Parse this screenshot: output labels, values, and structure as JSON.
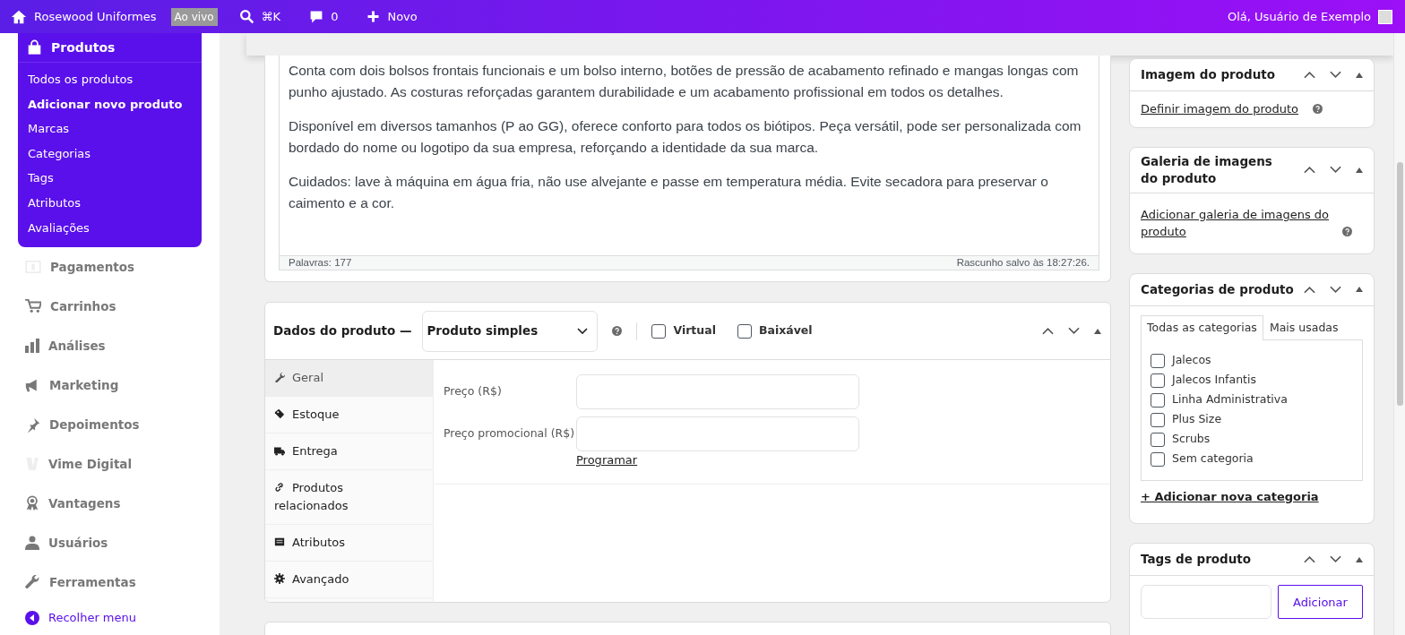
{
  "topbar": {
    "site": "Rosewood Uniformes",
    "live_badge": "Ao vivo",
    "search_shortcut": "⌘K",
    "comments": "0",
    "new_label": "Novo",
    "greeting": "Olá, Usuário de Exemplo"
  },
  "sidebar": {
    "flyout": {
      "title": "Produtos",
      "items": [
        {
          "label": "Todos os produtos",
          "selected": false
        },
        {
          "label": "Adicionar novo produto",
          "selected": true
        },
        {
          "label": "Marcas",
          "selected": false
        },
        {
          "label": "Categorias",
          "selected": false
        },
        {
          "label": "Tags",
          "selected": false
        },
        {
          "label": "Atributos",
          "selected": false
        },
        {
          "label": "Avaliações",
          "selected": false
        }
      ]
    },
    "items": [
      {
        "label": "Pagamentos"
      },
      {
        "label": "Carrinhos"
      },
      {
        "label": "Análises"
      },
      {
        "label": "Marketing"
      },
      {
        "label": "Depoimentos"
      },
      {
        "label": "Vime Digital"
      },
      {
        "label": "Vantagens"
      },
      {
        "label": "Usuários"
      },
      {
        "label": "Ferramentas"
      }
    ],
    "collapse": "Recolher menu"
  },
  "editor": {
    "paragraphs": [
      "Conta com dois bolsos frontais funcionais e um bolso interno, botões de pressão de acabamento refinado e mangas longas com punho ajustado. As costuras reforçadas garantem durabilidade e um acabamento profissional em todos os detalhes.",
      "Disponível em diversos tamanhos (P ao GG), oferece conforto para todos os biótipos. Peça versátil, pode ser personalizada com bordado do nome ou logotipo da sua empresa, reforçando a identidade da sua marca.",
      "Cuidados: lave à máquina em água fria, não use alvejante e passe em temperatura média. Evite secadora para preservar o caimento e a cor."
    ],
    "word_count": "Palavras: 177",
    "draft_saved": "Rascunho salvo às 18:27:26."
  },
  "product_data": {
    "title": "Dados do produto —",
    "type": "Produto simples",
    "options": [
      {
        "label": "Virtual",
        "checked": false
      },
      {
        "label": "Baixável",
        "checked": false
      }
    ],
    "tabs": [
      {
        "label": "Geral",
        "selected": true
      },
      {
        "label": "Estoque",
        "selected": false
      },
      {
        "label": "Entrega",
        "selected": false
      },
      {
        "label": "Produtos relacionados",
        "selected": false
      },
      {
        "label": "Atributos",
        "selected": false
      },
      {
        "label": "Avançado",
        "selected": false
      }
    ],
    "fields": [
      {
        "label": "Preço (R$)"
      },
      {
        "label": "Preço promocional (R$)",
        "link": "Programar"
      }
    ]
  },
  "side_panels": {
    "image": {
      "title": "Imagem do produto",
      "link": "Definir imagem do produto"
    },
    "gallery": {
      "title": "Galeria de imagens do produto",
      "link": "Adicionar galeria de imagens do produto"
    },
    "categories": {
      "title": "Categorias de produto",
      "tabs": [
        {
          "label": "Todas as categorias",
          "selected": true
        },
        {
          "label": "Mais usadas",
          "selected": false
        }
      ],
      "items": [
        {
          "label": "Jalecos",
          "checked": false
        },
        {
          "label": "Jalecos Infantis",
          "checked": false
        },
        {
          "label": "Linha Administrativa",
          "checked": false
        },
        {
          "label": "Plus Size",
          "checked": false
        },
        {
          "label": "Scrubs",
          "checked": false
        },
        {
          "label": "Sem categoria",
          "checked": false
        }
      ],
      "add_link": "+ Adicionar nova categoria"
    },
    "tags": {
      "title": "Tags de produto",
      "button": "Adicionar"
    }
  }
}
